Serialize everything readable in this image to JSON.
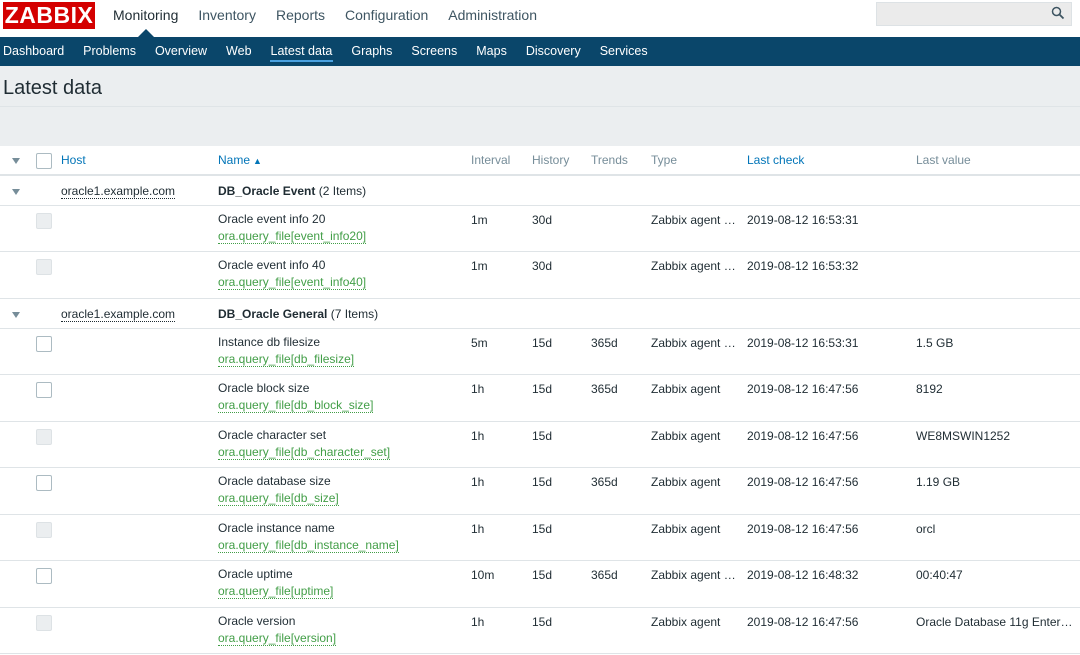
{
  "header": {
    "logo": "ZABBIX",
    "menu": [
      "Monitoring",
      "Inventory",
      "Reports",
      "Configuration",
      "Administration"
    ],
    "search_value": ""
  },
  "subnav": [
    "Dashboard",
    "Problems",
    "Overview",
    "Web",
    "Latest data",
    "Graphs",
    "Screens",
    "Maps",
    "Discovery",
    "Services"
  ],
  "page": {
    "title": "Latest data"
  },
  "table": {
    "columns": {
      "host": "Host",
      "name": "Name",
      "name_sort": "▲",
      "interval": "Interval",
      "history": "History",
      "trends": "Trends",
      "type": "Type",
      "last_check": "Last check",
      "last_value": "Last value"
    },
    "groups": [
      {
        "host": "oracle1.example.com",
        "app": "DB_Oracle Event",
        "count": "(2 Items)",
        "items": [
          {
            "name": "Oracle event info 20",
            "key": "ora.query_file[event_info20]",
            "interval": "1m",
            "history": "30d",
            "trends": "",
            "type": "Zabbix agent …",
            "last_check": "2019-08-12 16:53:31",
            "last_value": "",
            "graphable": false
          },
          {
            "name": "Oracle event info 40",
            "key": "ora.query_file[event_info40]",
            "interval": "1m",
            "history": "30d",
            "trends": "",
            "type": "Zabbix agent …",
            "last_check": "2019-08-12 16:53:32",
            "last_value": "",
            "graphable": false
          }
        ]
      },
      {
        "host": "oracle1.example.com",
        "app": "DB_Oracle General",
        "count": "(7 Items)",
        "items": [
          {
            "name": "Instance db filesize",
            "key": "ora.query_file[db_filesize]",
            "interval": "5m",
            "history": "15d",
            "trends": "365d",
            "type": "Zabbix agent …",
            "last_check": "2019-08-12 16:53:31",
            "last_value": "1.5 GB",
            "graphable": true
          },
          {
            "name": "Oracle block size",
            "key": "ora.query_file[db_block_size]",
            "interval": "1h",
            "history": "15d",
            "trends": "365d",
            "type": "Zabbix agent",
            "last_check": "2019-08-12 16:47:56",
            "last_value": "8192",
            "graphable": true
          },
          {
            "name": "Oracle character set",
            "key": "ora.query_file[db_character_set]",
            "interval": "1h",
            "history": "15d",
            "trends": "",
            "type": "Zabbix agent",
            "last_check": "2019-08-12 16:47:56",
            "last_value": "WE8MSWIN1252",
            "graphable": false
          },
          {
            "name": "Oracle database size",
            "key": "ora.query_file[db_size]",
            "interval": "1h",
            "history": "15d",
            "trends": "365d",
            "type": "Zabbix agent",
            "last_check": "2019-08-12 16:47:56",
            "last_value": "1.19 GB",
            "graphable": true
          },
          {
            "name": "Oracle instance name",
            "key": "ora.query_file[db_instance_name]",
            "interval": "1h",
            "history": "15d",
            "trends": "",
            "type": "Zabbix agent",
            "last_check": "2019-08-12 16:47:56",
            "last_value": "orcl",
            "graphable": false
          },
          {
            "name": "Oracle uptime",
            "key": "ora.query_file[uptime]",
            "interval": "10m",
            "history": "15d",
            "trends": "365d",
            "type": "Zabbix agent …",
            "last_check": "2019-08-12 16:48:32",
            "last_value": "00:40:47",
            "graphable": true
          },
          {
            "name": "Oracle version",
            "key": "ora.query_file[version]",
            "interval": "1h",
            "history": "15d",
            "trends": "",
            "type": "Zabbix agent",
            "last_check": "2019-08-12 16:47:56",
            "last_value": "Oracle Database 11g Enter…",
            "graphable": false
          }
        ]
      }
    ]
  }
}
